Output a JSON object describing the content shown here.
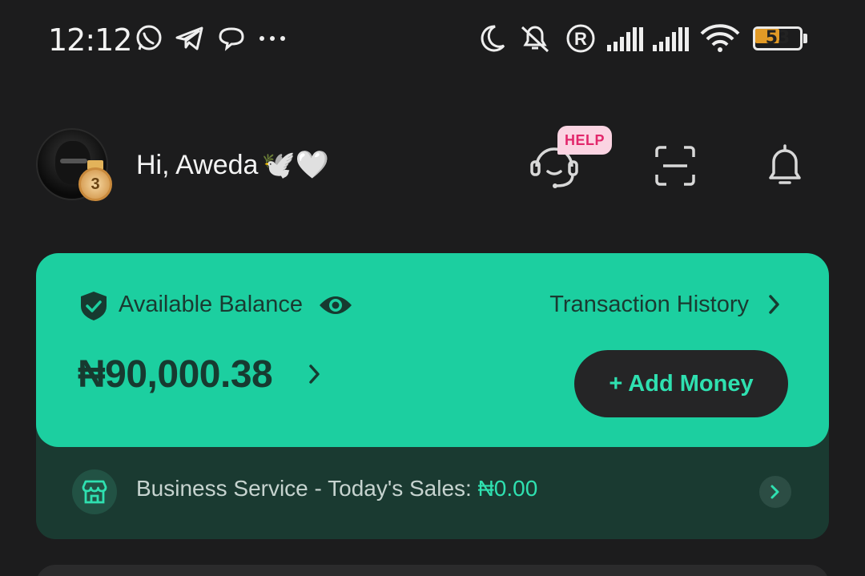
{
  "status_bar": {
    "time": "12:12",
    "battery_level": "53",
    "battery_fraction": 0.53,
    "icons": [
      "whatsapp-icon",
      "telegram-icon",
      "chat-bubble-icon",
      "more-dots-icon",
      "moon-icon",
      "muted-bell-icon",
      "registered-icon",
      "signal-bars-icon",
      "signal-bars-icon",
      "wifi-icon",
      "battery-icon"
    ]
  },
  "header": {
    "greeting": "Hi, Aweda",
    "greeting_emoji": "🕊️🤍",
    "medal_level": "3",
    "help_badge": "HELP",
    "icons": [
      "support-headset-icon",
      "scan-icon",
      "notification-bell-icon"
    ]
  },
  "balance_card": {
    "label": "Available Balance",
    "history_label": "Transaction History",
    "amount": "₦90,000.38",
    "add_money_label": "+ Add Money",
    "accent": "#1ccfa0"
  },
  "business": {
    "label": "Business Service - Today's Sales: ",
    "sales": "₦0.00"
  }
}
